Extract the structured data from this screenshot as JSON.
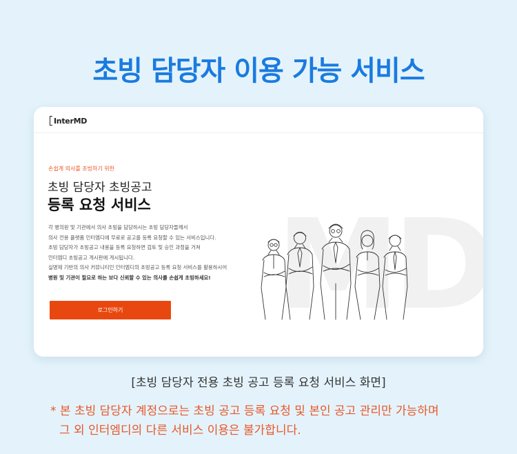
{
  "headline": "초빙 담당자 이용 가능 서비스",
  "card": {
    "logo_text": "InterMD",
    "watermark": "MD",
    "eyebrow": "손쉽게 의사를 초빙하기 위한",
    "title_line1": "초빙 담당자 초빙공고",
    "title_line2": "등록 요청 서비스",
    "description": [
      "각 병의원 및 기관에서 의사 초빙을 담당하시는 초빙 담당자들께서",
      "의사 전용 플랫폼 인터엠디에 무료로 공고를 등록 요청할 수 있는 서비스입니다.",
      "초빙 담당자가 초빙공고 내용을 등록 요청하면 검토 및 승인 과정을 거쳐",
      "인터엠디 초빙공고 게시판에 게시됩니다.",
      "실명제 기반의 의사 커뮤니티인 인터엠디의 초빙공고 등록 요청 서비스를 활용하시어"
    ],
    "description_strong": "병원 및 기관이 필요로 하는 보다 신뢰할 수 있는 의사를 손쉽게 초빙하세요!",
    "login_button": "로그인하기"
  },
  "caption": "[초빙 담당자 전용 초빙 공고 등록 요청 서비스 화면]",
  "notice_line1": "* 본 초빙 담당자 계정으로는 초빙 공고 등록 요청 및 본인 공고 관리만 가능하며",
  "notice_line2": "그 외 인터엠디의 다른 서비스 이용은 불가합니다.",
  "colors": {
    "background": "#e4f3fb",
    "headline": "#1a7be0",
    "accent": "#e84810",
    "notice": "#e8572a"
  },
  "illustration": "line-art-group-of-business-people-with-crossed-arms"
}
